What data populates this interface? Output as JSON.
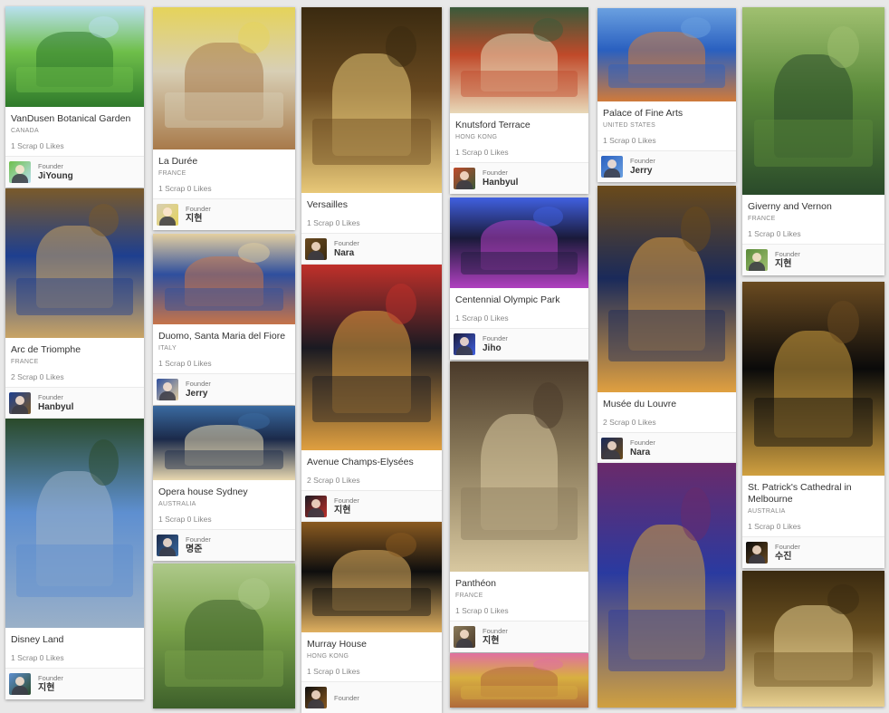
{
  "founder_label": "Founder",
  "stats_sep": " ",
  "cards": [
    {
      "title": "VanDusen Botanical Garden",
      "country": "CANADA",
      "scrap": "1 Scrap",
      "likes": "0 Likes",
      "founder": "JiYoung",
      "photo_icon": "garden-photo",
      "palette": [
        "#6fbf4a",
        "#2f7a2b",
        "#b9e0f0"
      ]
    },
    {
      "title": "Arc de Triomphe",
      "country": "FRANCE",
      "scrap": "2 Scrap",
      "likes": "0 Likes",
      "founder": "Hanbyul",
      "photo_icon": "arch-photo",
      "palette": [
        "#1e3f8f",
        "#c9a465",
        "#7a5a2a"
      ]
    },
    {
      "title": "Disney Land",
      "country": "",
      "scrap": "1 Scrap",
      "likes": "0 Likes",
      "founder": "지현",
      "photo_icon": "castle-photo",
      "palette": [
        "#5e8fd0",
        "#9ab0c8",
        "#2a4a2a"
      ]
    },
    {
      "title": "",
      "country": "",
      "scrap": "",
      "likes": "",
      "founder": "",
      "photo_icon": "willow-photo",
      "palette": [
        "#7aa24a",
        "#3d5f2a",
        "#aec98a"
      ]
    },
    {
      "title": "La Durée",
      "country": "FRANCE",
      "scrap": "1 Scrap",
      "likes": "0 Likes",
      "founder": "지현",
      "photo_icon": "macaron-photo",
      "palette": [
        "#d8cfb5",
        "#a87a4a",
        "#e5d35a"
      ]
    },
    {
      "title": "Duomo, Santa Maria del Fiore",
      "country": "ITALY",
      "scrap": "1 Scrap",
      "likes": "0 Likes",
      "founder": "Jerry",
      "photo_icon": "duomo-photo",
      "palette": [
        "#2f4f9e",
        "#c6744a",
        "#e4cfa0"
      ]
    },
    {
      "title": "Opera house Sydney",
      "country": "AUSTRALIA",
      "scrap": "1 Scrap",
      "likes": "0 Likes",
      "founder": "명준",
      "photo_icon": "opera-house-photo",
      "palette": [
        "#1b2a4a",
        "#e8d8b0",
        "#3a6aa0"
      ]
    },
    {
      "title": "",
      "country": "",
      "scrap": "",
      "likes": "",
      "founder": "",
      "photo_icon": "willow-photo",
      "palette": [
        "#8bb35a",
        "#4a6a2a",
        "#b9d48a"
      ]
    },
    {
      "title": "Versailles",
      "country": "",
      "scrap": "1 Scrap",
      "likes": "0 Likes",
      "founder": "Nara",
      "photo_icon": "chandelier-photo",
      "palette": [
        "#6a4a20",
        "#e8c878",
        "#3a2a10"
      ]
    },
    {
      "title": "Avenue Champs-Elysées",
      "country": "",
      "scrap": "2 Scrap",
      "likes": "0 Likes",
      "founder": "지현",
      "photo_icon": "night-avenue-photo",
      "palette": [
        "#1a1a22",
        "#e0a040",
        "#c0302a"
      ]
    },
    {
      "title": "Murray House",
      "country": "HONG KONG",
      "scrap": "1 Scrap",
      "likes": "0 Likes",
      "founder": "",
      "photo_icon": "colonnade-photo",
      "palette": [
        "#0e0e0e",
        "#e0b060",
        "#8a5a20"
      ]
    },
    {
      "title": "Knutsford Terrace",
      "country": "HONG KONG",
      "scrap": "1 Scrap",
      "likes": "0 Likes",
      "founder": "Hanbyul",
      "photo_icon": "terrace-photo",
      "palette": [
        "#c04a2a",
        "#e8d8b8",
        "#3a5a3a"
      ]
    },
    {
      "title": "Centennial Olympic Park",
      "country": "",
      "scrap": "1 Scrap",
      "likes": "0 Likes",
      "founder": "Jiho",
      "photo_icon": "fountain-photo",
      "palette": [
        "#1a1a3a",
        "#b040c0",
        "#4060e0"
      ]
    },
    {
      "title": "Panthéon",
      "country": "FRANCE",
      "scrap": "1 Scrap",
      "likes": "0 Likes",
      "founder": "지현",
      "photo_icon": "dome-interior-photo",
      "palette": [
        "#8a7a5a",
        "#d8c8a0",
        "#4a3a2a"
      ]
    },
    {
      "title": "",
      "country": "",
      "scrap": "",
      "likes": "",
      "founder": "",
      "photo_icon": "macaron-photo",
      "palette": [
        "#d8b040",
        "#b06a3a",
        "#e070a0"
      ]
    },
    {
      "title": "Palace of Fine Arts",
      "country": "UNITED STATES",
      "scrap": "1 Scrap",
      "likes": "0 Likes",
      "founder": "Jerry",
      "photo_icon": "palace-photo",
      "palette": [
        "#2a60c0",
        "#d07a3a",
        "#6aa0e0"
      ]
    },
    {
      "title": "Musée du Louvre",
      "country": "",
      "scrap": "2 Scrap",
      "likes": "0 Likes",
      "founder": "Nara",
      "photo_icon": "louvre-photo",
      "palette": [
        "#1a2a5a",
        "#e0a040",
        "#6a4a1a"
      ]
    },
    {
      "title": "",
      "country": "",
      "scrap": "",
      "likes": "",
      "founder": "",
      "photo_icon": "stained-glass-photo",
      "palette": [
        "#2a3aa0",
        "#d0a040",
        "#6a2a6a"
      ]
    },
    {
      "title": "Giverny and Vernon",
      "country": "FRANCE",
      "scrap": "1 Scrap",
      "likes": "0 Likes",
      "founder": "지현",
      "photo_icon": "lily-pond-photo",
      "palette": [
        "#5a8a3a",
        "#2a4a2a",
        "#a0c070"
      ]
    },
    {
      "title": "St. Patrick's Cathedral in Melbourne",
      "country": "AUSTRALIA",
      "scrap": "1 Scrap",
      "likes": "0 Likes",
      "founder": "수진",
      "photo_icon": "cathedral-photo",
      "palette": [
        "#0a0a0a",
        "#d0a040",
        "#6a4a20"
      ]
    },
    {
      "title": "",
      "country": "",
      "scrap": "",
      "likes": "",
      "founder": "",
      "photo_icon": "chandelier-photo",
      "palette": [
        "#6a5020",
        "#e8d090",
        "#3a2a10"
      ]
    }
  ]
}
